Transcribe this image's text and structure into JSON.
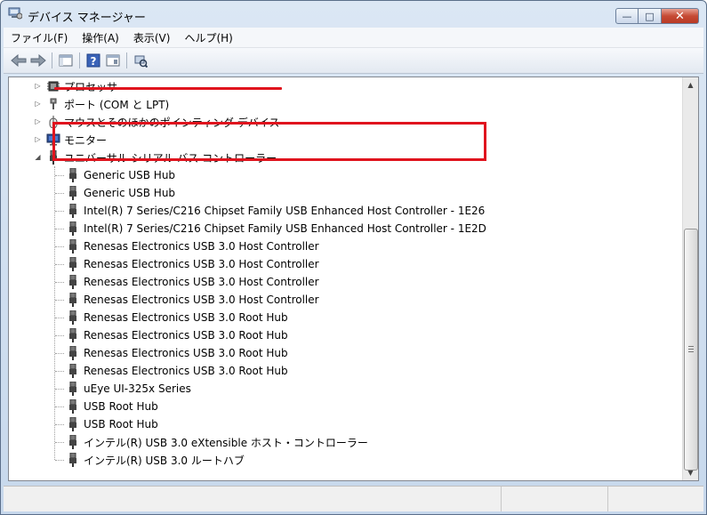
{
  "window": {
    "title": "デバイス マネージャー"
  },
  "caption_buttons": {
    "minimize": "—",
    "maximize": "□",
    "close": "✕"
  },
  "menu": [
    {
      "label": "ファイル(F)"
    },
    {
      "label": "操作(A)"
    },
    {
      "label": "表示(V)"
    },
    {
      "label": "ヘルプ(H)"
    }
  ],
  "toolbar": {
    "icons": [
      "back-arrow-icon",
      "forward-arrow-icon",
      "console-tree-icon",
      "help-icon",
      "properties-icon",
      "scan-hardware-icon"
    ]
  },
  "tree": {
    "categories": [
      {
        "label": "プロセッサ",
        "icon": "processor-icon",
        "expanded": false
      },
      {
        "label": "ポート (COM と LPT)",
        "icon": "port-icon",
        "expanded": false
      },
      {
        "label": "マウスとそのほかのポインティング デバイス",
        "icon": "mouse-icon",
        "expanded": false
      },
      {
        "label": "モニター",
        "icon": "monitor-icon",
        "expanded": false
      },
      {
        "label": "ユニバーサル シリアル バス コントローラー",
        "icon": "usb-icon",
        "expanded": true
      }
    ],
    "usb_devices": [
      "Generic USB Hub",
      "Generic USB Hub",
      "Intel(R) 7 Series/C216 Chipset Family USB Enhanced Host Controller - 1E26",
      "Intel(R) 7 Series/C216 Chipset Family USB Enhanced Host Controller - 1E2D",
      "Renesas Electronics USB 3.0 Host Controller",
      "Renesas Electronics USB 3.0 Host Controller",
      "Renesas Electronics USB 3.0 Host Controller",
      "Renesas Electronics USB 3.0 Host Controller",
      "Renesas Electronics USB 3.0 Root Hub",
      "Renesas Electronics USB 3.0 Root Hub",
      "Renesas Electronics USB 3.0 Root Hub",
      "Renesas Electronics USB 3.0 Root Hub",
      "uEye UI-325x Series",
      "USB Root Hub",
      "USB Root Hub",
      "インテル(R) USB 3.0 eXtensible ホスト・コントローラー",
      "インテル(R) USB 3.0 ルートハブ"
    ]
  },
  "colors": {
    "highlight_red": "#e0141e",
    "title_gradient_top": "#dbe7f4"
  }
}
